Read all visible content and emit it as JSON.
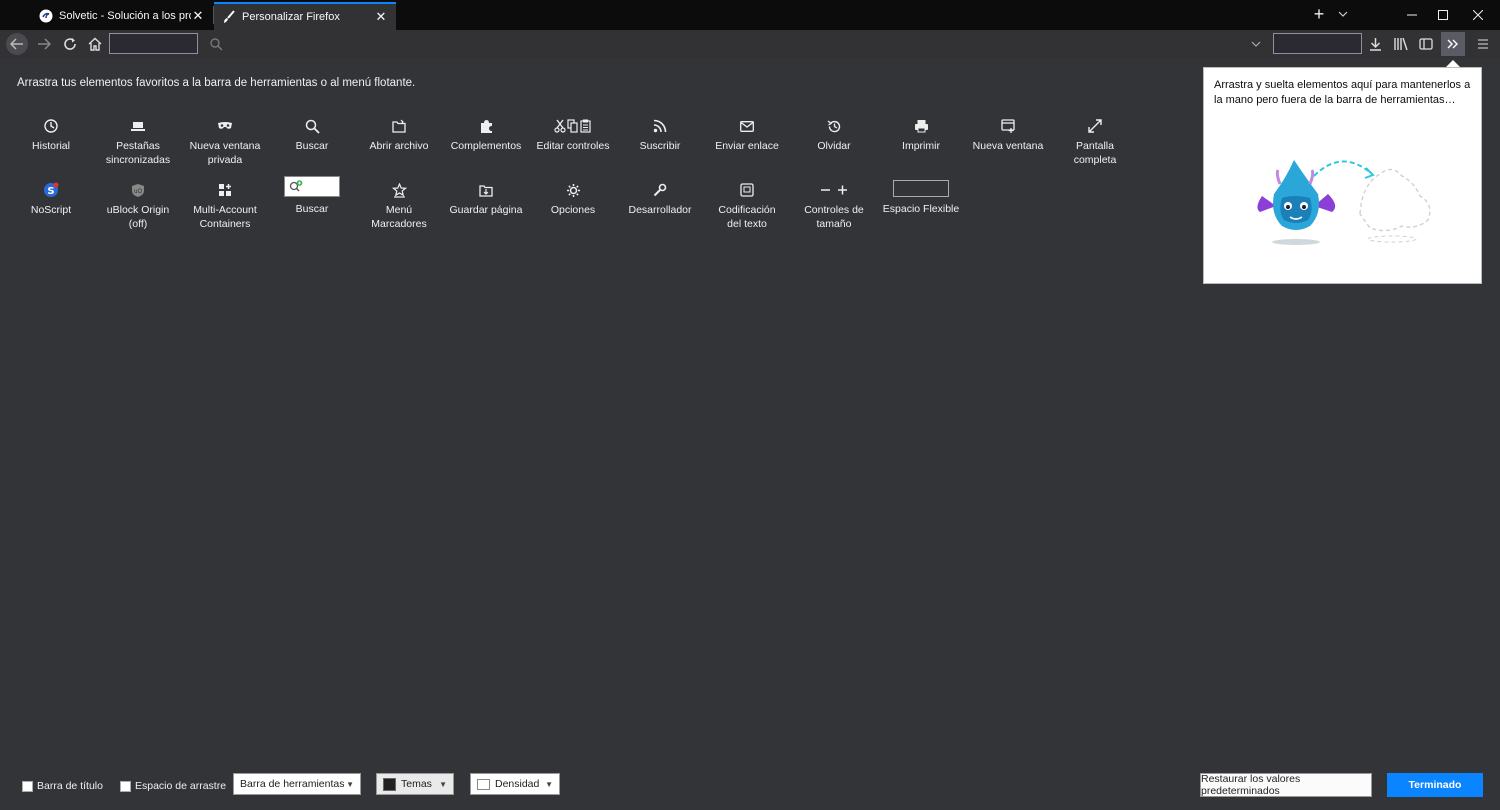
{
  "tabs": [
    {
      "label": "Solvetic - Solución a los problemas",
      "icon": "solvetic-favicon-icon",
      "active": false
    },
    {
      "label": "Personalizar Firefox",
      "icon": "paintbrush-icon",
      "active": true
    }
  ],
  "window_controls": {
    "minimize": "minimize-icon",
    "maximize": "maximize-icon",
    "close": "close-icon"
  },
  "colors": {
    "background": "#333438",
    "accent": "#0a84ff",
    "tabbar": "#0c0c0d"
  },
  "customize": {
    "instruction": "Arrastra tus elementos favoritos a la barra de herramientas o al menú flotante.",
    "items_row1": [
      {
        "label": "Historial",
        "icon": "history-icon"
      },
      {
        "label": "Pestañas\nsincronizadas",
        "icon": "synced-tabs-icon"
      },
      {
        "label": "Nueva ventana\nprivada",
        "icon": "private-window-icon"
      },
      {
        "label": "Buscar",
        "icon": "search-icon"
      },
      {
        "label": "Abrir archivo",
        "icon": "open-file-icon"
      },
      {
        "label": "Complementos",
        "icon": "addons-icon"
      },
      {
        "label": "Editar controles",
        "icon": "edit-controls-icon"
      },
      {
        "label": "Suscribir",
        "icon": "rss-icon"
      },
      {
        "label": "Enviar enlace",
        "icon": "email-link-icon"
      },
      {
        "label": "Olvidar",
        "icon": "forget-icon"
      },
      {
        "label": "Imprimir",
        "icon": "print-icon"
      },
      {
        "label": "Nueva ventana",
        "icon": "new-window-icon"
      },
      {
        "label": "Pantalla\ncompleta",
        "icon": "fullscreen-icon"
      }
    ],
    "items_row2": [
      {
        "label": "NoScript",
        "icon": "noscript-icon"
      },
      {
        "label": "uBlock Origin\n(off)",
        "icon": "ublock-icon"
      },
      {
        "label": "Multi-Account\nContainers",
        "icon": "containers-icon"
      },
      {
        "label": "Buscar",
        "icon": "search-field-icon"
      },
      {
        "label": "Menú\nMarcadores",
        "icon": "bookmarks-menu-icon"
      },
      {
        "label": "Guardar página",
        "icon": "save-page-icon"
      },
      {
        "label": "Opciones",
        "icon": "options-gear-icon"
      },
      {
        "label": "Desarrollador",
        "icon": "wrench-icon"
      },
      {
        "label": "Codificación\ndel texto",
        "icon": "text-encoding-icon"
      },
      {
        "label": "Controles de\ntamaño",
        "icon": "zoom-controls-icon"
      },
      {
        "label": "Espacio Flexible",
        "icon": "flexible-space-icon"
      }
    ]
  },
  "overflow_panel": {
    "text": "Arrastra y suelta elementos aquí para mantenerlos a la mano pero fuera de la barra de herramientas…"
  },
  "footer": {
    "title_bar_label": "Barra de título",
    "drag_space_label": "Espacio de arrastre",
    "toolbars_label": "Barra de herramientas",
    "themes_label": "Temas",
    "density_label": "Densidad",
    "restore_label": "Restaurar los valores predeterminados",
    "done_label": "Terminado"
  }
}
